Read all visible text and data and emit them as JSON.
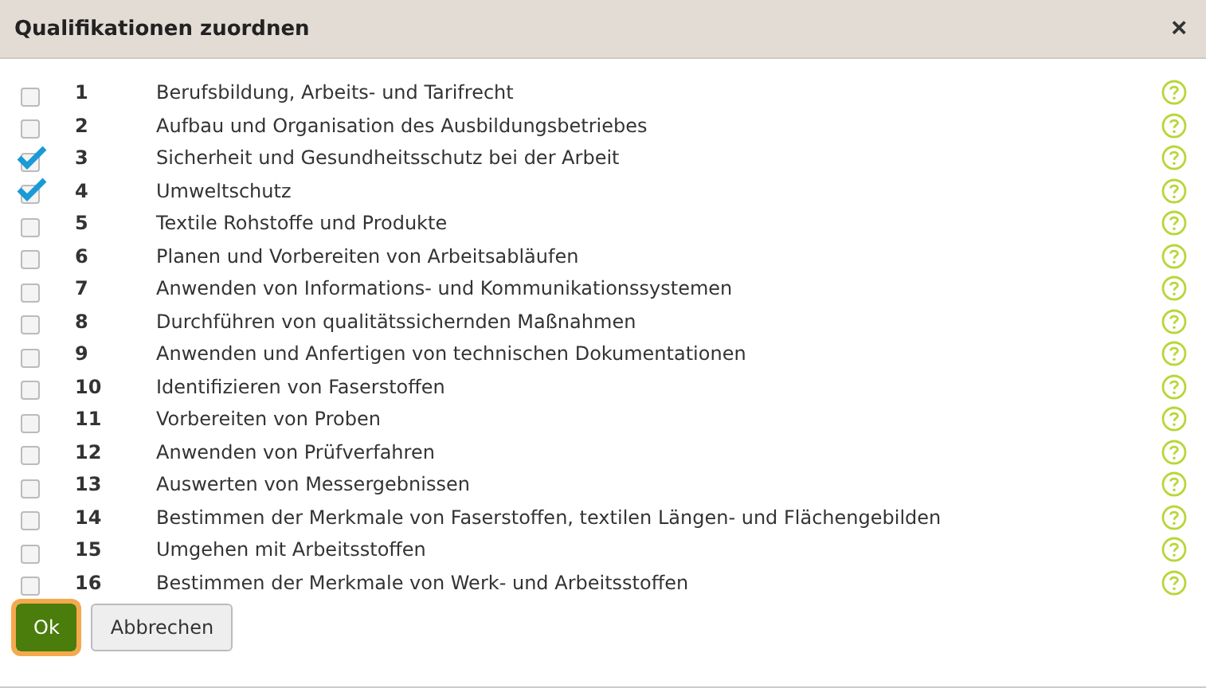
{
  "dialog": {
    "title": "Qualifikationen zuordnen",
    "close": "×"
  },
  "items": [
    {
      "number": "1",
      "label": "Berufsbildung, Arbeits- und Tarifrecht",
      "checked": false
    },
    {
      "number": "2",
      "label": "Aufbau und Organisation des Ausbildungsbetriebes",
      "checked": false
    },
    {
      "number": "3",
      "label": "Sicherheit und Gesundheitsschutz bei der Arbeit",
      "checked": true
    },
    {
      "number": "4",
      "label": "Umweltschutz",
      "checked": true
    },
    {
      "number": "5",
      "label": "Textile Rohstoffe und Produkte",
      "checked": false
    },
    {
      "number": "6",
      "label": "Planen und Vorbereiten von Arbeitsabläufen",
      "checked": false
    },
    {
      "number": "7",
      "label": "Anwenden von Informations- und Kommunikationssystemen",
      "checked": false
    },
    {
      "number": "8",
      "label": "Durchführen von qualitätssichernden Maßnahmen",
      "checked": false
    },
    {
      "number": "9",
      "label": "Anwenden und Anfertigen von technischen Dokumentationen",
      "checked": false
    },
    {
      "number": "10",
      "label": "Identifizieren von Faserstoffen",
      "checked": false
    },
    {
      "number": "11",
      "label": "Vorbereiten von Proben",
      "checked": false
    },
    {
      "number": "12",
      "label": "Anwenden von Prüfverfahren",
      "checked": false
    },
    {
      "number": "13",
      "label": "Auswerten von Messergebnissen",
      "checked": false
    },
    {
      "number": "14",
      "label": "Bestimmen der Merkmale von Faserstoffen, textilen Längen- und Flächengebilden",
      "checked": false
    },
    {
      "number": "15",
      "label": "Umgehen mit Arbeitsstoffen",
      "checked": false
    },
    {
      "number": "16",
      "label": "Bestimmen der Merkmale von Werk- und Arbeitsstoffen",
      "checked": false
    }
  ],
  "buttons": [
    {
      "label": "Ok",
      "kind": "primary"
    },
    {
      "label": "Abbrechen",
      "kind": "secondary"
    }
  ]
}
